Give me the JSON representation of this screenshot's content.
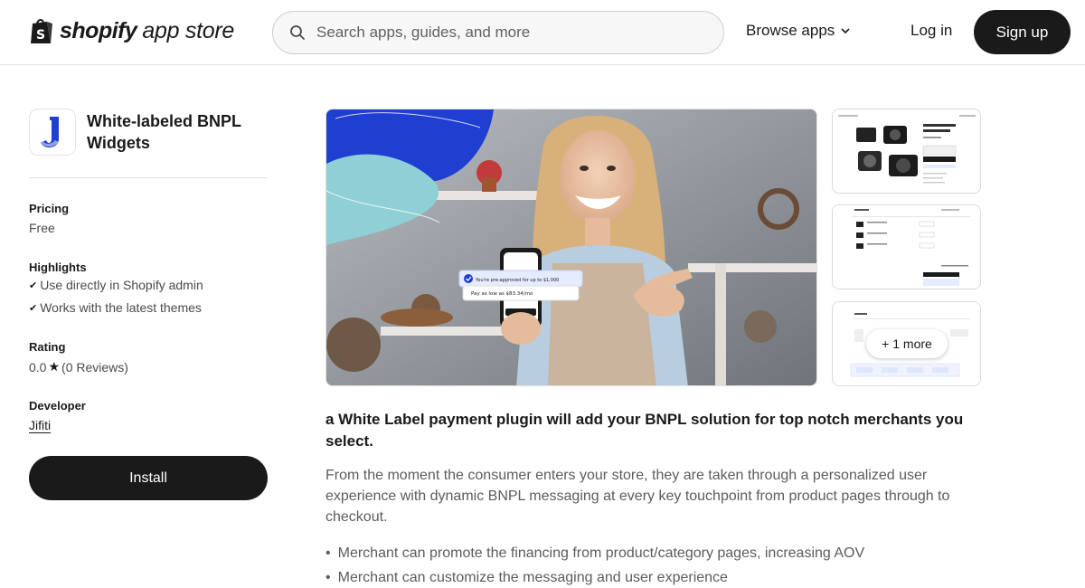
{
  "header": {
    "logo_word": "shopify",
    "logo_sub": "app store",
    "search_placeholder": "Search apps, guides, and more",
    "browse_label": "Browse apps",
    "login_label": "Log in",
    "signup_label": "Sign up"
  },
  "app": {
    "name": "White-labeled BNPL Widgets",
    "icon_letter": "J"
  },
  "sidebar": {
    "pricing_label": "Pricing",
    "pricing_value": "Free",
    "highlights_label": "Highlights",
    "highlights": [
      "Use directly in Shopify admin",
      "Works with the latest themes"
    ],
    "rating_label": "Rating",
    "rating_value": "0.0",
    "rating_reviews": "(0 Reviews)",
    "developer_label": "Developer",
    "developer_name": "Jifiti",
    "install_label": "Install"
  },
  "media": {
    "more_label": "+ 1 more",
    "phone_banner": "You're pre-approved for up to $1,000",
    "phone_offer": "Pay as low as $83.34/mo"
  },
  "description": {
    "headline": "a White Label payment plugin will add your BNPL solution for top notch merchants you select.",
    "body": "From the moment the consumer enters your store, they are taken through a personalized user experience with dynamic BNPL messaging at every key touchpoint from product pages through to checkout.",
    "bullets": [
      "Merchant can promote the financing from product/category pages, increasing AOV",
      "Merchant can customize the messaging and user experience"
    ]
  },
  "colors": {
    "primary": "#1a1a1a",
    "accent_blue": "#1f3fd1",
    "accent_teal": "#8fd0d6"
  }
}
